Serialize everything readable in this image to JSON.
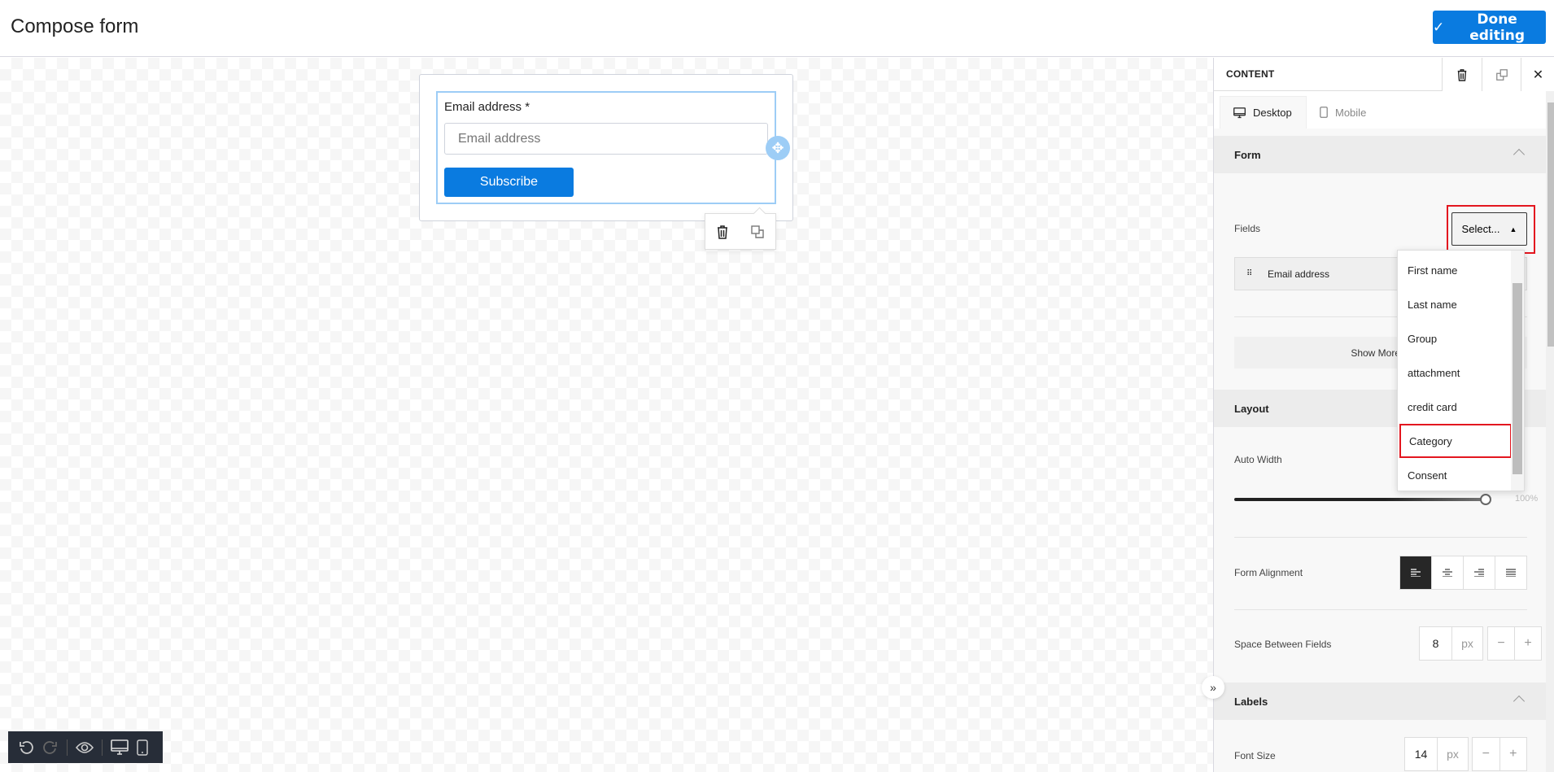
{
  "header": {
    "title": "Compose form",
    "done_label": "Done editing"
  },
  "canvas": {
    "form": {
      "field_label": "Email address *",
      "field_placeholder": "Email address",
      "submit_label": "Subscribe"
    }
  },
  "panel": {
    "title": "CONTENT",
    "tabs": [
      {
        "label": "Desktop",
        "active": true
      },
      {
        "label": "Mobile",
        "active": false
      }
    ],
    "form_section": {
      "title": "Form",
      "fields_label": "Fields",
      "select_label": "Select...",
      "fields": [
        "Email address"
      ],
      "show_more_label": "Show More O",
      "dropdown_options": [
        "First name",
        "Last name",
        "Group",
        "attachment",
        "credit card",
        "Category",
        "Consent"
      ],
      "highlighted_option": "Category"
    },
    "layout_section": {
      "title": "Layout",
      "auto_width_label": "Auto Width",
      "auto_width_value": "100%",
      "form_alignment_label": "Form Alignment",
      "form_alignment_selected": "left",
      "space_between_label": "Space Between Fields",
      "space_between_value": "8",
      "space_between_unit": "px"
    },
    "labels_section": {
      "title": "Labels",
      "font_size_label": "Font Size",
      "font_size_value": "14",
      "font_size_unit": "px"
    }
  },
  "colors": {
    "accent": "#0a7be0",
    "highlight": "#e3161f",
    "toolbar": "#272d38"
  }
}
